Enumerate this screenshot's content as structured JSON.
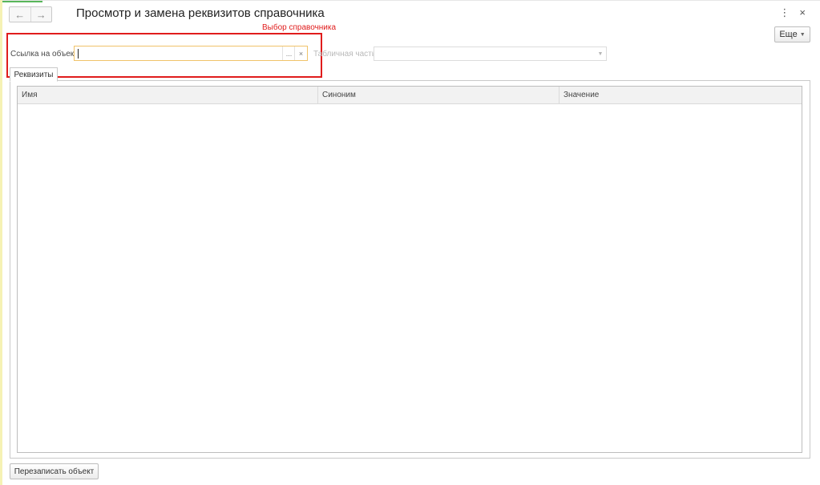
{
  "window": {
    "title": "Просмотр и замена реквизитов справочника",
    "more_label": "Еще"
  },
  "annotation": {
    "label": "Выбор справочника",
    "color": "#e01c1c"
  },
  "form": {
    "object_field": {
      "label": "Ссылка на объект:",
      "value": "",
      "select_glyph": "...",
      "clear_glyph": "×"
    },
    "table_part_field": {
      "label": "Табличная часть:",
      "value": ""
    }
  },
  "tabs": [
    {
      "label": "Реквизиты",
      "active": true
    }
  ],
  "grid": {
    "columns": [
      "Имя",
      "Синоним",
      "Значение"
    ],
    "rows": []
  },
  "footer": {
    "rewrite_label": "Перезаписать объект"
  },
  "icons": {
    "back": "arrow-left-icon",
    "forward": "arrow-right-icon",
    "menu": "kebab-menu-icon",
    "close": "close-icon"
  }
}
